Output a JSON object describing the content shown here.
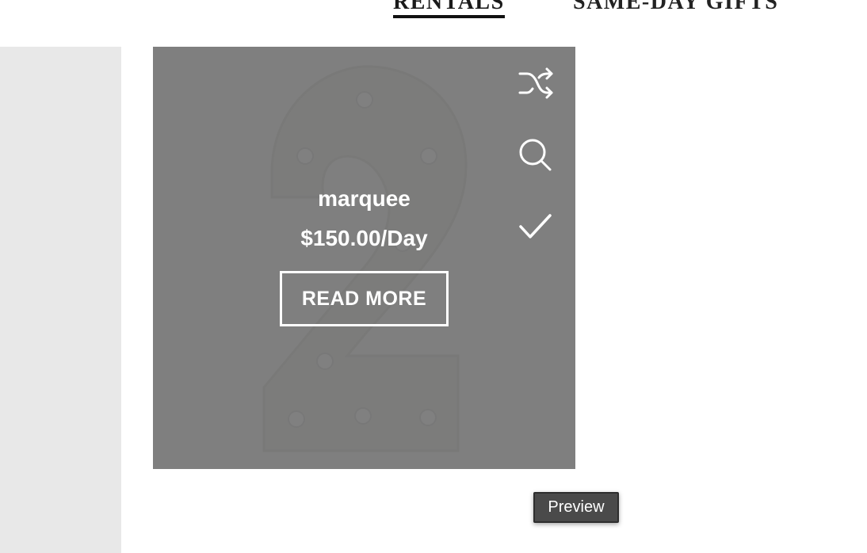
{
  "nav": {
    "rentals_label": "RENTALS",
    "gifts_label": "SAME-DAY GIFTS"
  },
  "product": {
    "title": "marquee",
    "price": "$150.00/Day",
    "read_more_label": "READ MORE",
    "image_alt": "marquee number 2 with light bulbs"
  },
  "actions": {
    "compare_icon": "shuffle-icon",
    "search_icon": "search-icon",
    "check_icon": "check-icon"
  },
  "preview": {
    "label": "Preview"
  },
  "colors": {
    "overlay": "#6e6e6e",
    "sidebar": "#e8e8e8",
    "nav_text": "#1a1a1a"
  }
}
